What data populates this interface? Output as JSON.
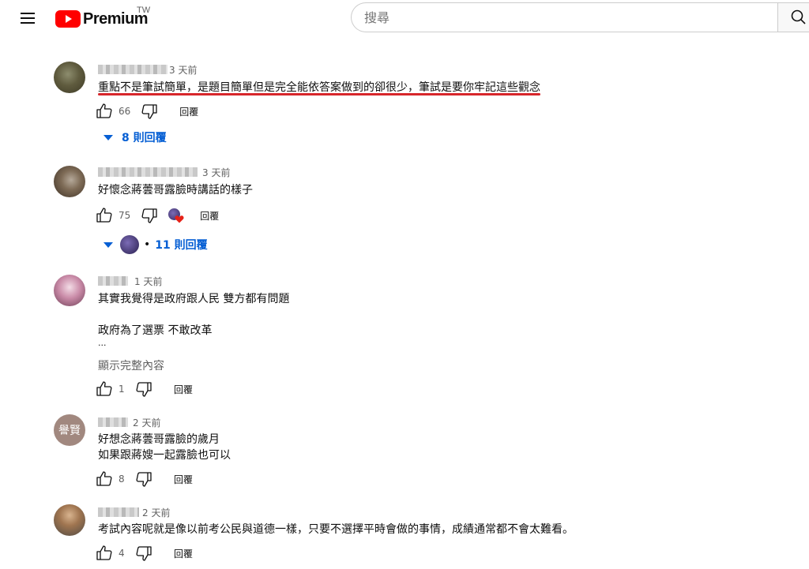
{
  "header": {
    "logo_text": "Premium",
    "logo_country": "TW",
    "search_placeholder": "搜尋",
    "search_value": ""
  },
  "colors": {
    "brand_red": "#ff0000",
    "link_blue": "#065fd4",
    "underline_red": "#d7262b"
  },
  "icons": [
    "menu-icon",
    "youtube-logo-icon",
    "search-icon",
    "thumbs-up-icon",
    "thumbs-down-icon",
    "caret-down-icon",
    "heart-icon"
  ],
  "comments": [
    {
      "time": "3 天前",
      "lines": [
        "重點不是筆試簡單，是題目簡單但是完全能依答案做到的卻很少，筆試是要你牢記這些觀念"
      ],
      "likes": "66",
      "reply_label": "回覆",
      "replies": "8 則回覆"
    },
    {
      "time": "3 天前",
      "lines": [
        "好懷念蔣蕓哥露臉時講話的樣子"
      ],
      "likes": "75",
      "reply_label": "回覆",
      "replies": "11 則回覆",
      "replies_sep": "•"
    },
    {
      "time": "1 天前",
      "lines": [
        "其實我覺得是政府跟人民 雙方都有問題",
        "",
        "政府為了選票 不敢改革",
        "..."
      ],
      "show_more": "顯示完整內容",
      "likes": "1",
      "reply_label": "回覆"
    },
    {
      "time": "2 天前",
      "avatar_text": "譽賢",
      "lines": [
        "好想念蔣蕓哥露臉的歲月",
        "如果跟蔣嫂一起露臉也可以"
      ],
      "likes": "8",
      "reply_label": "回覆"
    },
    {
      "time": "2 天前",
      "lines": [
        "考試內容呢就是像以前考公民與道德一樣，只要不選擇平時會做的事情，成績通常都不會太難看。"
      ],
      "likes": "4",
      "reply_label": "回覆"
    }
  ]
}
